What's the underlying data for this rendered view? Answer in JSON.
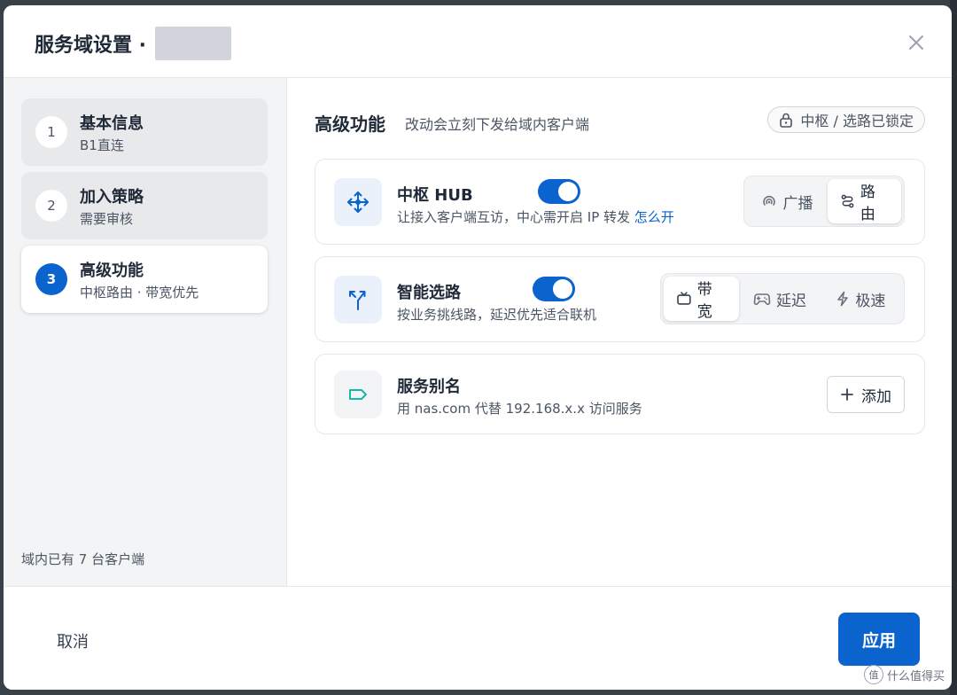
{
  "header": {
    "title": "服务域设置 ·"
  },
  "sidebar": {
    "steps": [
      {
        "num": "1",
        "title": "基本信息",
        "sub": "B1直连"
      },
      {
        "num": "2",
        "title": "加入策略",
        "sub": "需要审核"
      },
      {
        "num": "3",
        "title": "高级功能",
        "sub": "中枢路由 · 带宽优先"
      }
    ],
    "footer": "域内已有 7 台客户端"
  },
  "main": {
    "section_title": "高级功能",
    "section_sub": "改动会立刻下发给域内客户端",
    "lock_badge": "中枢 / 选路已锁定",
    "hub": {
      "title": "中枢 HUB",
      "desc": "让接入客户端互访，中心需开启 IP 转发",
      "link": "怎么开",
      "toggle_on": true,
      "options": [
        "广播",
        "路由"
      ],
      "selected": "路由"
    },
    "smart_route": {
      "title": "智能选路",
      "desc": "按业务挑线路，延迟优先适合联机",
      "toggle_on": true,
      "options": [
        "带宽",
        "延迟",
        "极速"
      ],
      "selected": "带宽"
    },
    "alias": {
      "title": "服务别名",
      "desc": "用 nas.com 代替 192.168.x.x 访问服务",
      "add_label": "添加"
    }
  },
  "footer": {
    "cancel_label": "取消",
    "apply_label": "应用"
  },
  "watermark": "什么值得买",
  "colors": {
    "accent": "#0b63ce",
    "sidebar_bg": "#f3f4f6",
    "alias_icon": "#14b8a6"
  }
}
